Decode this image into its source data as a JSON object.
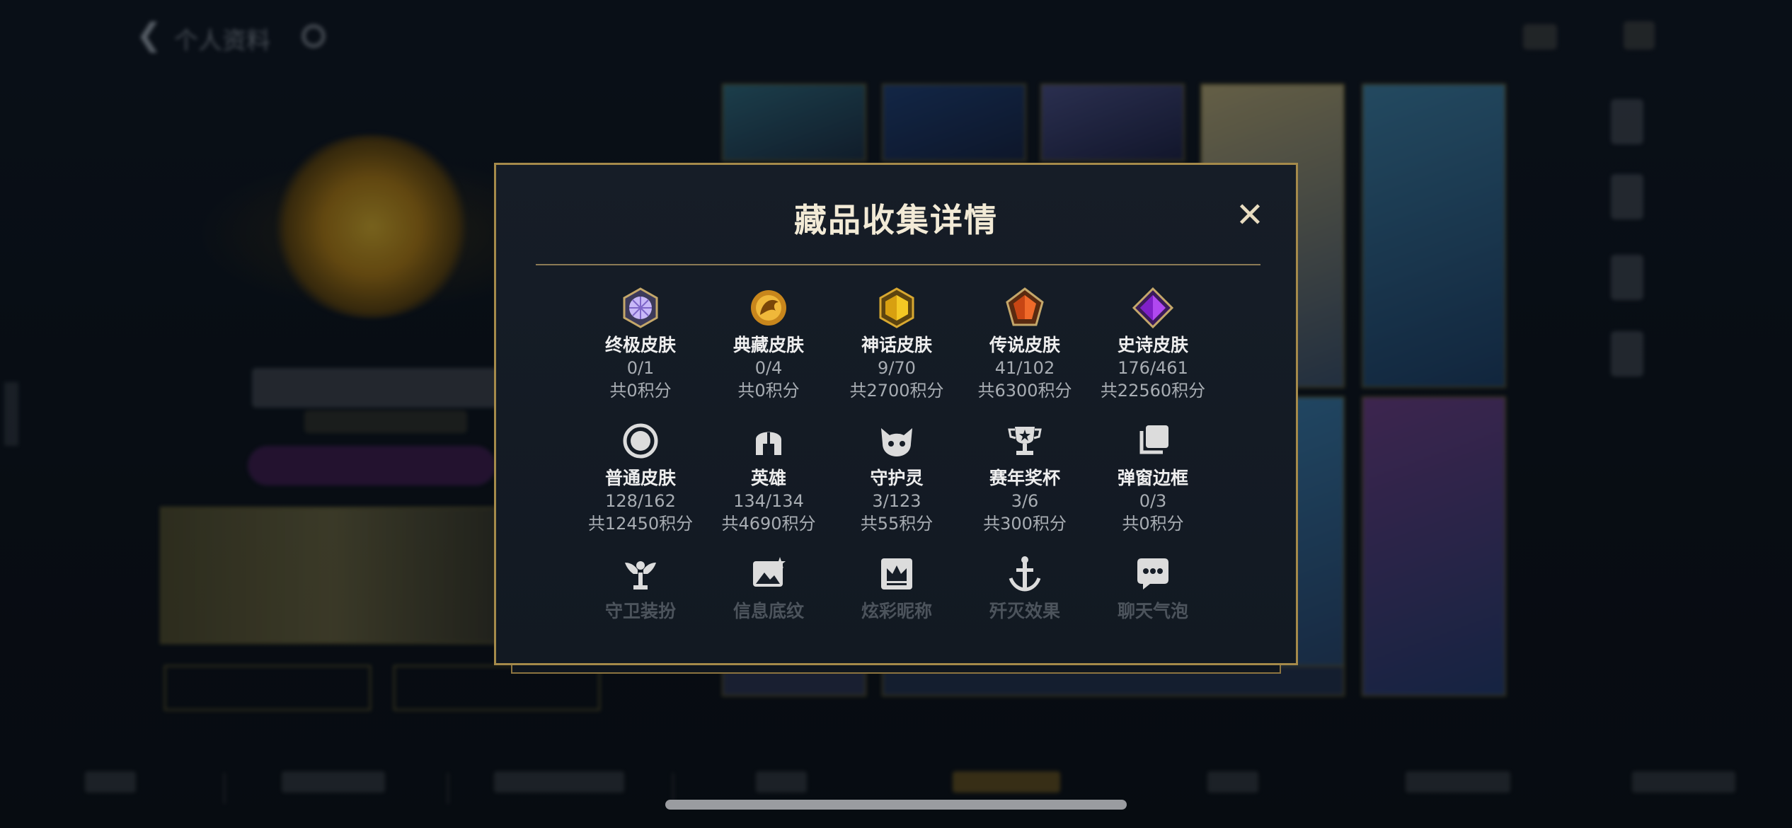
{
  "header": {
    "title": "个人资料",
    "back_icon": "chevron-left-icon",
    "settings_icon": "gear-icon"
  },
  "modal": {
    "title": "藏品收集详情",
    "close_glyph": "✕",
    "items": [
      {
        "name": "终极皮肤",
        "count": "0/1",
        "points": "共0积分",
        "icon": "ultimate-gem-icon",
        "color": "#b8a8f0"
      },
      {
        "name": "典藏皮肤",
        "count": "0/4",
        "points": "共0积分",
        "icon": "dragon-emblem-icon",
        "color": "#e0a020"
      },
      {
        "name": "神话皮肤",
        "count": "9/70",
        "points": "共2700积分",
        "icon": "mythic-gem-icon",
        "color": "#f0c020"
      },
      {
        "name": "传说皮肤",
        "count": "41/102",
        "points": "共6300积分",
        "icon": "legendary-gem-icon",
        "color": "#e8602a"
      },
      {
        "name": "史诗皮肤",
        "count": "176/461",
        "points": "共22560积分",
        "icon": "epic-gem-icon",
        "color": "#a040e0"
      },
      {
        "name": "普通皮肤",
        "count": "128/162",
        "points": "共12450积分",
        "icon": "ring-icon",
        "color": "#d8d8d8"
      },
      {
        "name": "英雄",
        "count": "134/134",
        "points": "共4690积分",
        "icon": "helmet-icon",
        "color": "#d8d8d8"
      },
      {
        "name": "守护灵",
        "count": "3/123",
        "points": "共55积分",
        "icon": "guardian-pet-icon",
        "color": "#d8d8d8"
      },
      {
        "name": "赛年奖杯",
        "count": "3/6",
        "points": "共300积分",
        "icon": "trophy-icon",
        "color": "#d8d8d8"
      },
      {
        "name": "弹窗边框",
        "count": "0/3",
        "points": "共0积分",
        "icon": "frame-stack-icon",
        "color": "#d8d8d8"
      },
      {
        "name": "守卫装扮",
        "icon": "ward-icon",
        "color": "#d8d8d8"
      },
      {
        "name": "信息底纹",
        "icon": "image-card-icon",
        "color": "#d8d8d8"
      },
      {
        "name": "炫彩昵称",
        "icon": "crown-card-icon",
        "color": "#d8d8d8"
      },
      {
        "name": "歼灭效果",
        "icon": "sword-icon",
        "color": "#d8d8d8"
      },
      {
        "name": "聊天气泡",
        "icon": "chat-bubble-icon",
        "color": "#d8d8d8"
      }
    ]
  },
  "colors": {
    "accent_gold": "#a58a4a",
    "modal_bg": "#141b24"
  }
}
